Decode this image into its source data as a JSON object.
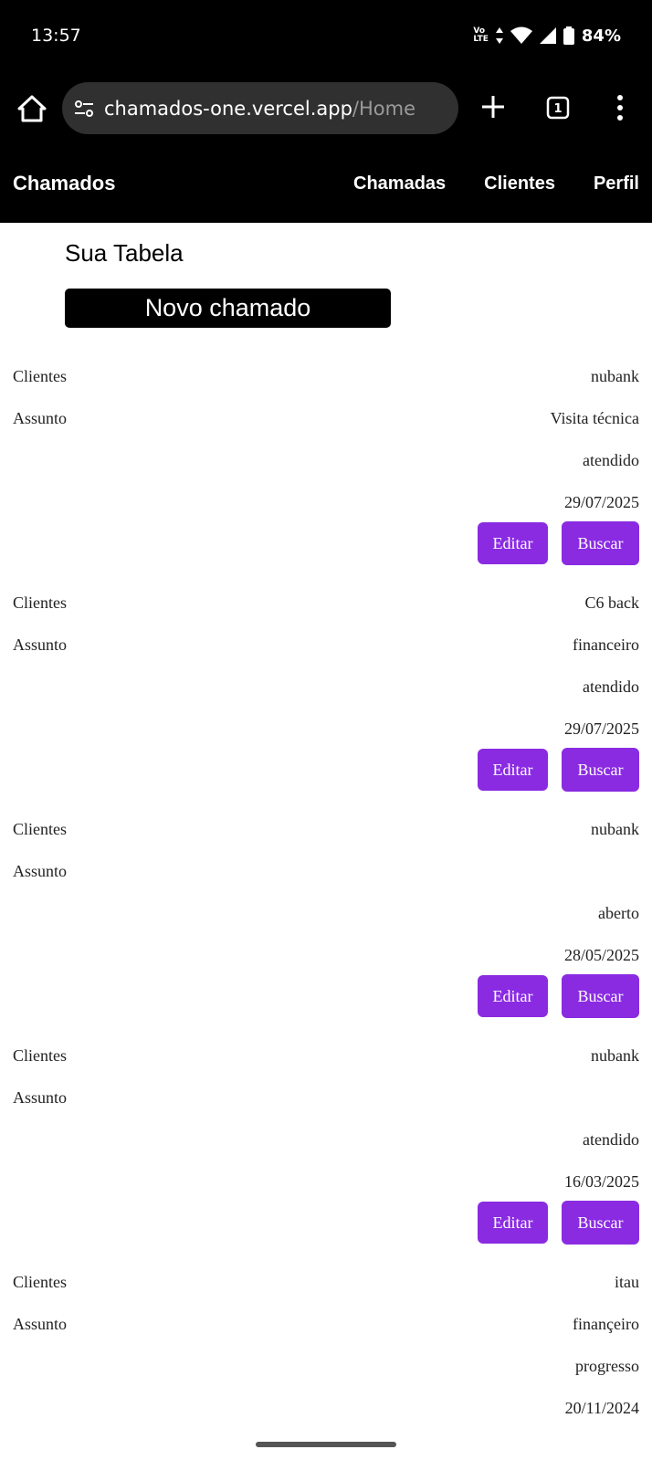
{
  "status_bar": {
    "time": "13:57",
    "network": "Vo LTE",
    "battery": "84%"
  },
  "browser": {
    "url_host": "chamados-one.vercel.app",
    "url_path": "/Home",
    "tab_count": "1"
  },
  "nav": {
    "brand": "Chamados",
    "links": [
      "Chamadas",
      "Clientes",
      "Perfil"
    ]
  },
  "main": {
    "title": "Sua Tabela",
    "new_button": "Novo chamado",
    "labels": {
      "clientes": "Clientes",
      "assunto": "Assunto"
    },
    "buttons": {
      "edit": "Editar",
      "search": "Buscar"
    },
    "tickets": [
      {
        "cliente": "nubank",
        "assunto": "Visita técnica",
        "status": "atendido",
        "data": "29/07/2025"
      },
      {
        "cliente": "C6 back",
        "assunto": "financeiro",
        "status": "atendido",
        "data": "29/07/2025"
      },
      {
        "cliente": "nubank",
        "assunto": "",
        "status": "aberto",
        "data": "28/05/2025"
      },
      {
        "cliente": "nubank",
        "assunto": "",
        "status": "atendido",
        "data": "16/03/2025"
      },
      {
        "cliente": "itau",
        "assunto": "finançeiro",
        "status": "progresso",
        "data": "20/11/2024"
      }
    ]
  }
}
